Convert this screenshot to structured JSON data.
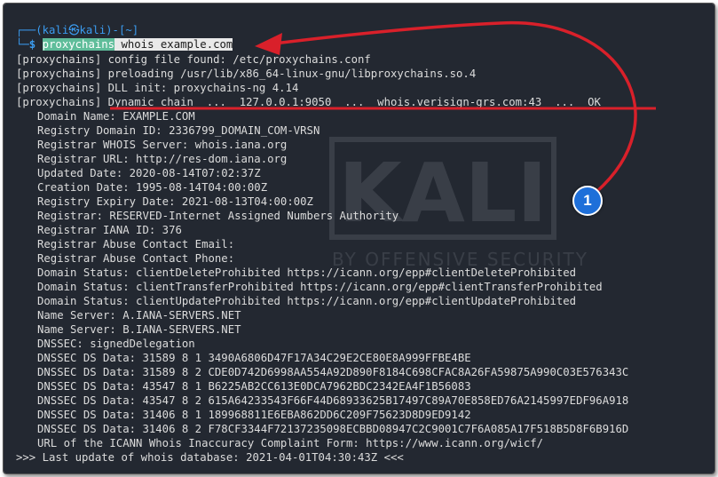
{
  "prompt": {
    "top": "┌──(kali㉿kali)-[~]",
    "bottom": "└─$ ",
    "command_highlight": "proxychains",
    "command_rest": " whois example.com"
  },
  "proxy_lines": [
    "[proxychains] config file found: /etc/proxychains.conf",
    "[proxychains] preloading /usr/lib/x86_64-linux-gnu/libproxychains.so.4",
    "[proxychains] DLL init: proxychains-ng 4.14",
    "[proxychains] Dynamic chain  ...  127.0.0.1:9050  ...  whois.verisign-grs.com:43  ...  OK"
  ],
  "whois_lines": [
    "Domain Name: EXAMPLE.COM",
    "Registry Domain ID: 2336799_DOMAIN_COM-VRSN",
    "Registrar WHOIS Server: whois.iana.org",
    "Registrar URL: http://res-dom.iana.org",
    "Updated Date: 2020-08-14T07:02:37Z",
    "Creation Date: 1995-08-14T04:00:00Z",
    "Registry Expiry Date: 2021-08-13T04:00:00Z",
    "Registrar: RESERVED-Internet Assigned Numbers Authority",
    "Registrar IANA ID: 376",
    "Registrar Abuse Contact Email:",
    "Registrar Abuse Contact Phone:",
    "Domain Status: clientDeleteProhibited https://icann.org/epp#clientDeleteProhibited",
    "Domain Status: clientTransferProhibited https://icann.org/epp#clientTransferProhibited",
    "Domain Status: clientUpdateProhibited https://icann.org/epp#clientUpdateProhibited",
    "Name Server: A.IANA-SERVERS.NET",
    "Name Server: B.IANA-SERVERS.NET",
    "DNSSEC: signedDelegation",
    "DNSSEC DS Data: 31589 8 1 3490A6806D47F17A34C29E2CE80E8A999FFBE4BE",
    "DNSSEC DS Data: 31589 8 2 CDE0D742D6998AA554A92D890F8184C698CFAC8A26FA59875A990C03E576343C",
    "DNSSEC DS Data: 43547 8 1 B6225AB2CC613E0DCA7962BDC2342EA4F1B56083",
    "DNSSEC DS Data: 43547 8 2 615A64233543F66F44D68933625B17497C89A70E858ED76A2145997EDF96A918",
    "DNSSEC DS Data: 31406 8 1 189968811E6EBA862DD6C209F75623D8D9ED9142",
    "DNSSEC DS Data: 31406 8 2 F78CF3344F72137235098ECBBD08947C2C9001C7F6A085A17F518B5D8F6B916D",
    "URL of the ICANN Whois Inaccuracy Complaint Form: https://www.icann.org/wicf/"
  ],
  "last_line": ">>> Last update of whois database: 2021-04-01T04:30:43Z <<<",
  "watermark": {
    "logo": "KALI",
    "tagline": "BY OFFENSIVE SECURITY"
  },
  "annotation": {
    "badge": "1",
    "color": "#d9202a"
  },
  "colors": {
    "background": "#232831",
    "text": "#dcdcdc",
    "prompt": "#3b9cf0",
    "highlight": "#5fbd9a",
    "badge": "#1e6fd9"
  }
}
